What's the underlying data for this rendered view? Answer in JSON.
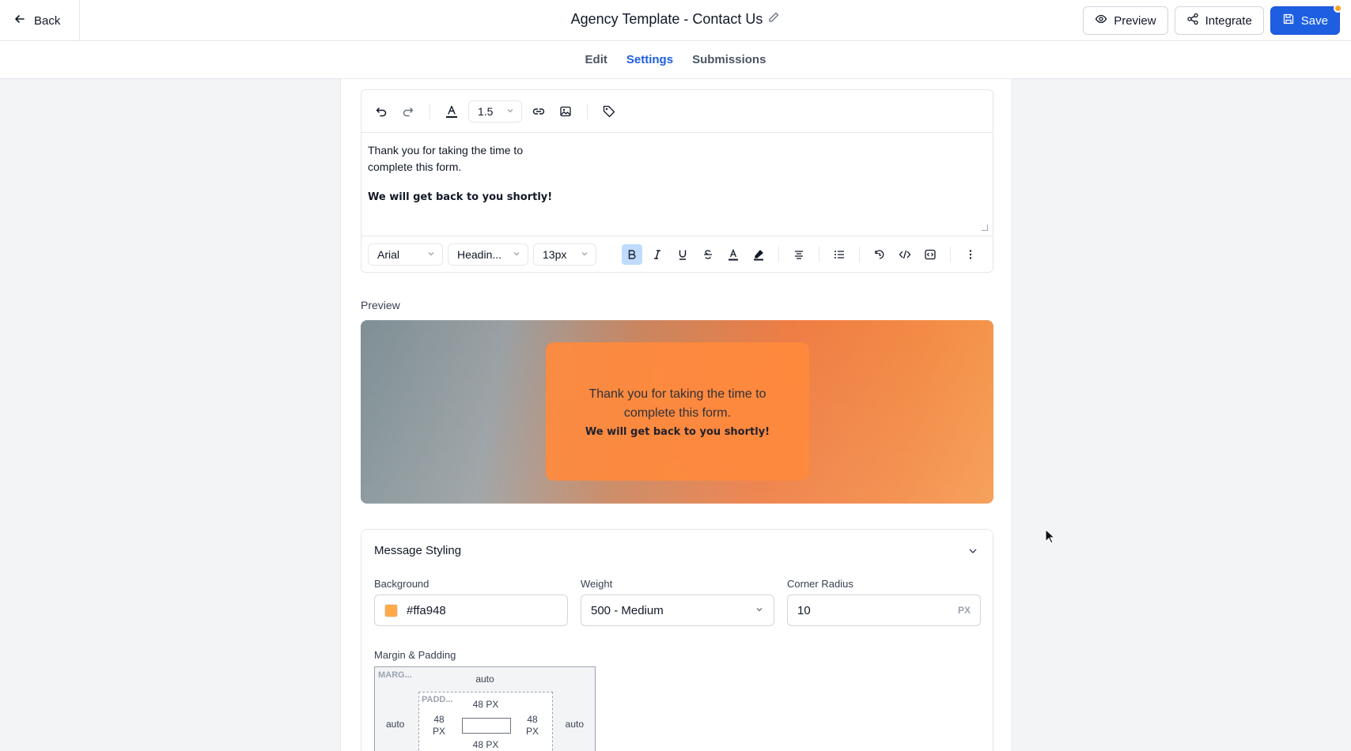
{
  "header": {
    "back_label": "Back",
    "title": "Agency Template - Contact Us",
    "preview_label": "Preview",
    "integrate_label": "Integrate",
    "save_label": "Save"
  },
  "tabs": [
    {
      "label": "Edit",
      "active": false
    },
    {
      "label": "Settings",
      "active": true
    },
    {
      "label": "Submissions",
      "active": false
    }
  ],
  "editor": {
    "line_height": "1.5",
    "body_line1": "Thank you for taking the time to",
    "body_line2": "complete this form.",
    "body_bold": "We will get back to you shortly!",
    "font_family": "Arial",
    "block_format": "Headin...",
    "font_size": "13px"
  },
  "preview": {
    "label": "Preview",
    "line1": "Thank you for taking the time to",
    "line2": "complete this form.",
    "bold": "We will get back to you shortly!"
  },
  "styling": {
    "title": "Message Styling",
    "background_label": "Background",
    "background_value": "#ffa948",
    "weight_label": "Weight",
    "weight_value": "500 - Medium",
    "radius_label": "Corner Radius",
    "radius_value": "10",
    "radius_unit": "PX",
    "margin_padding_label": "Margin & Padding",
    "margin_label": "MARG...",
    "padding_label": "PADD...",
    "margin_top": "auto",
    "margin_left": "auto",
    "margin_right": "auto",
    "padding_top": "48 PX",
    "padding_left": "48\nPX",
    "padding_right": "48\nPX",
    "padding_bottom": "48 PX"
  },
  "colors": {
    "accent": "#1d5fe0",
    "notification_dot": "#f5a524",
    "message_background": "#ffa948"
  }
}
